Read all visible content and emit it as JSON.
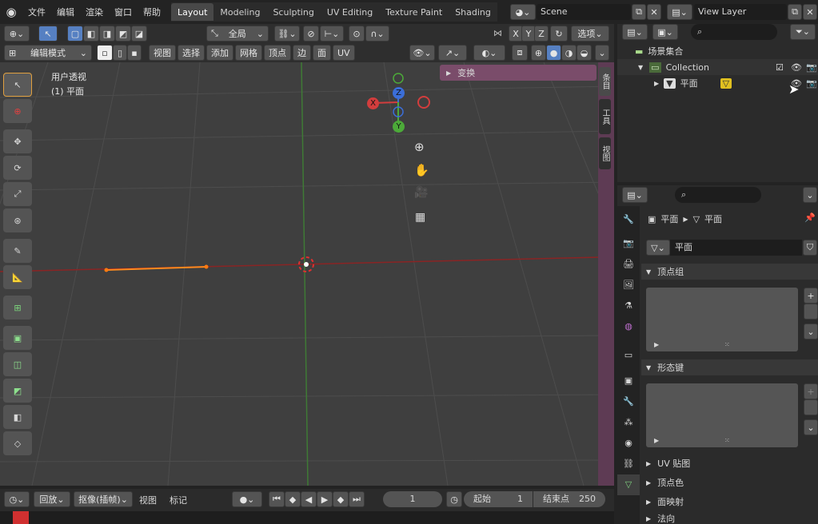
{
  "topbar": {
    "menus": [
      "文件",
      "编辑",
      "渲染",
      "窗口",
      "帮助"
    ],
    "workspaces": [
      "Layout",
      "Modeling",
      "Sculpting",
      "UV Editing",
      "Texture Paint",
      "Shading"
    ],
    "active_workspace": "Layout",
    "scene": "Scene",
    "view_layer": "View Layer"
  },
  "viewport_header": {
    "transform_orientation": "全局",
    "axes": [
      "X",
      "Y",
      "Z"
    ],
    "options": "选项",
    "mode": "编辑模式",
    "menus": [
      "视图",
      "选择",
      "添加",
      "网格",
      "顶点",
      "边",
      "面",
      "UV"
    ]
  },
  "viewport": {
    "view_name": "用户透视",
    "object_label": "(1) 平面",
    "n_panel_header": "变换",
    "side_tabs": [
      "条目",
      "工具",
      "视图"
    ],
    "gizmo_axes": [
      "X",
      "Y",
      "Z"
    ]
  },
  "outliner": {
    "root": "场景集合",
    "collection": "Collection",
    "object": "平面"
  },
  "properties": {
    "breadcrumb_object": "平面",
    "breadcrumb_mesh": "平面",
    "mesh_name": "平面",
    "panels": [
      "顶点组",
      "形态键",
      "UV 贴图",
      "顶点色",
      "面映射",
      "法向"
    ]
  },
  "timeline": {
    "playback": "回放",
    "keying": "抠像(插帧)",
    "view": "视图",
    "marker": "标记",
    "current_frame": "1",
    "start_label": "起始",
    "start": "1",
    "end_label": "结束点",
    "end": "250"
  },
  "colors": {
    "accent": "#5680c2",
    "x_axis": "#d23d3d",
    "y_axis": "#4caa39",
    "z_axis": "#3b6ed8",
    "selection": "#ff8a1e"
  }
}
